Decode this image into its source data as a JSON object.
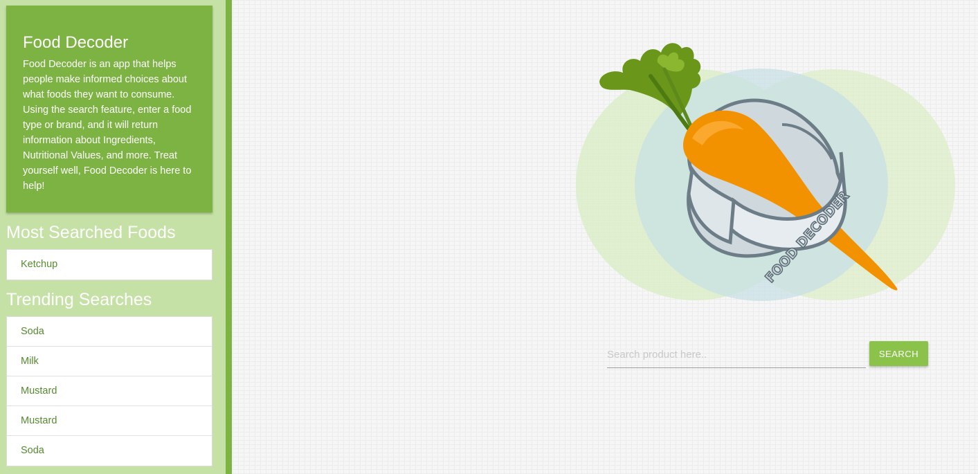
{
  "about": {
    "title": "Food Decoder",
    "text": "Food Decoder is an app that helps people make informed choices about what foods they want to consume. Using the search feature, enter a food type or brand, and it will return information about Ingredients, Nutritional Values, and more. Treat yourself well, Food Decoder is here to help!"
  },
  "most_searched": {
    "title": "Most Searched Foods",
    "items": [
      "Ketchup"
    ]
  },
  "trending": {
    "title": "Trending Searches",
    "items": [
      "Soda",
      "Milk",
      "Mustard",
      "Mustard",
      "Soda"
    ]
  },
  "logo": {
    "ring_text": "FOOD DECODER",
    "icon": "carrot-ring-logo"
  },
  "search": {
    "placeholder": "Search product here..",
    "value": "",
    "button_label": "SEARCH"
  },
  "colors": {
    "sidebar_bg": "#c5e1a5",
    "accent_green": "#7cb342",
    "button_green": "#8bc34a",
    "link_green": "#558b2f",
    "carrot_orange": "#f39200"
  }
}
